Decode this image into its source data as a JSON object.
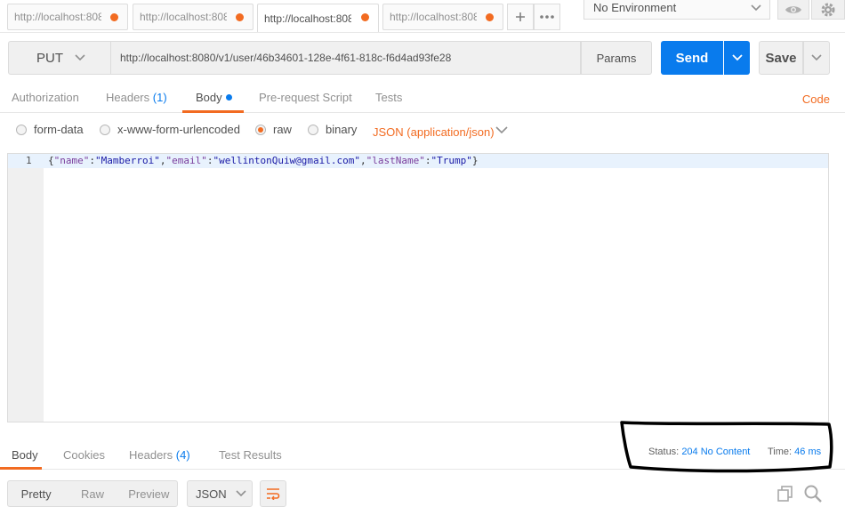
{
  "tabs": [
    {
      "label": "http://localhost:808"
    },
    {
      "label": "http://localhost:808"
    },
    {
      "label": "http://localhost:808"
    },
    {
      "label": "http://localhost:808"
    }
  ],
  "environment": {
    "selected": "No Environment"
  },
  "request": {
    "method": "PUT",
    "url": "http://localhost:8080/v1/user/46b34601-128e-4f61-818c-f6d4ad93fe28",
    "params_label": "Params",
    "send_label": "Send",
    "save_label": "Save"
  },
  "request_tabs": {
    "authorization": "Authorization",
    "headers": "Headers",
    "headers_count": "(1)",
    "body": "Body",
    "prerequest": "Pre-request Script",
    "tests": "Tests",
    "code": "Code"
  },
  "body_modes": {
    "form_data": "form-data",
    "urlencoded": "x-www-form-urlencoded",
    "raw": "raw",
    "binary": "binary",
    "selected": "raw",
    "content_type": "JSON (application/json)"
  },
  "editor": {
    "line_number": "1",
    "p1": "{",
    "k1": "\"name\"",
    "p2": ":",
    "v1": "\"Mamberroi\"",
    "p3": ",",
    "k2": "\"email\"",
    "p4": ":",
    "v2": "\"wellintonQuiw@gmail.com\"",
    "p5": ",",
    "k3": "\"lastName\"",
    "p6": ":",
    "v3": "\"Trump\"",
    "p7": "}"
  },
  "response_tabs": {
    "body": "Body",
    "cookies": "Cookies",
    "headers": "Headers",
    "headers_count": "(4)",
    "test_results": "Test Results"
  },
  "response": {
    "status_label": "Status:",
    "status_value": "204 No Content",
    "time_label": "Time:",
    "time_value": "46 ms"
  },
  "response_view": {
    "pretty": "Pretty",
    "raw": "Raw",
    "preview": "Preview",
    "format": "JSON"
  },
  "colors": {
    "accent": "#f26b21",
    "primary": "#097bed"
  }
}
